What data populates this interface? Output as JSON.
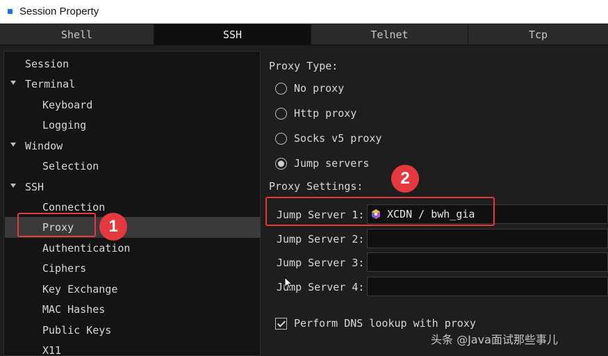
{
  "window": {
    "title": "Session Property"
  },
  "tabs": [
    {
      "label": "Shell",
      "active": false
    },
    {
      "label": "SSH",
      "active": true
    },
    {
      "label": "Telnet",
      "active": false
    },
    {
      "label": "Tcp",
      "active": false
    }
  ],
  "tree": {
    "items": [
      {
        "label": "Session"
      },
      {
        "label": "Terminal"
      },
      {
        "label": "Keyboard"
      },
      {
        "label": "Logging"
      },
      {
        "label": "Window"
      },
      {
        "label": "Selection"
      },
      {
        "label": "SSH"
      },
      {
        "label": "Connection"
      },
      {
        "label": "Proxy"
      },
      {
        "label": "Authentication"
      },
      {
        "label": "Ciphers"
      },
      {
        "label": "Key Exchange"
      },
      {
        "label": "MAC Hashes"
      },
      {
        "label": "Public Keys"
      },
      {
        "label": "X11"
      }
    ],
    "selected": "Proxy"
  },
  "proxy": {
    "type_label": "Proxy Type:",
    "options": [
      {
        "label": "No proxy",
        "checked": false
      },
      {
        "label": "Http proxy",
        "checked": false
      },
      {
        "label": "Socks v5 proxy",
        "checked": false
      },
      {
        "label": "Jump servers",
        "checked": true
      }
    ],
    "settings_label": "Proxy Settings:",
    "jump_servers": [
      {
        "label": "Jump Server 1:",
        "value": "XCDN / bwh_gia",
        "icon": "server-group-icon"
      },
      {
        "label": "Jump Server 2:",
        "value": ""
      },
      {
        "label": "Jump Server 3:",
        "value": ""
      },
      {
        "label": "Jump Server 4:",
        "value": ""
      }
    ],
    "dns_lookup": {
      "label": "Perform DNS lookup with proxy",
      "checked": true
    }
  },
  "annotations": {
    "badge_1": "1",
    "badge_2": "2",
    "accent": "#e5393f"
  },
  "watermark": "头条 @Java面试那些事儿"
}
